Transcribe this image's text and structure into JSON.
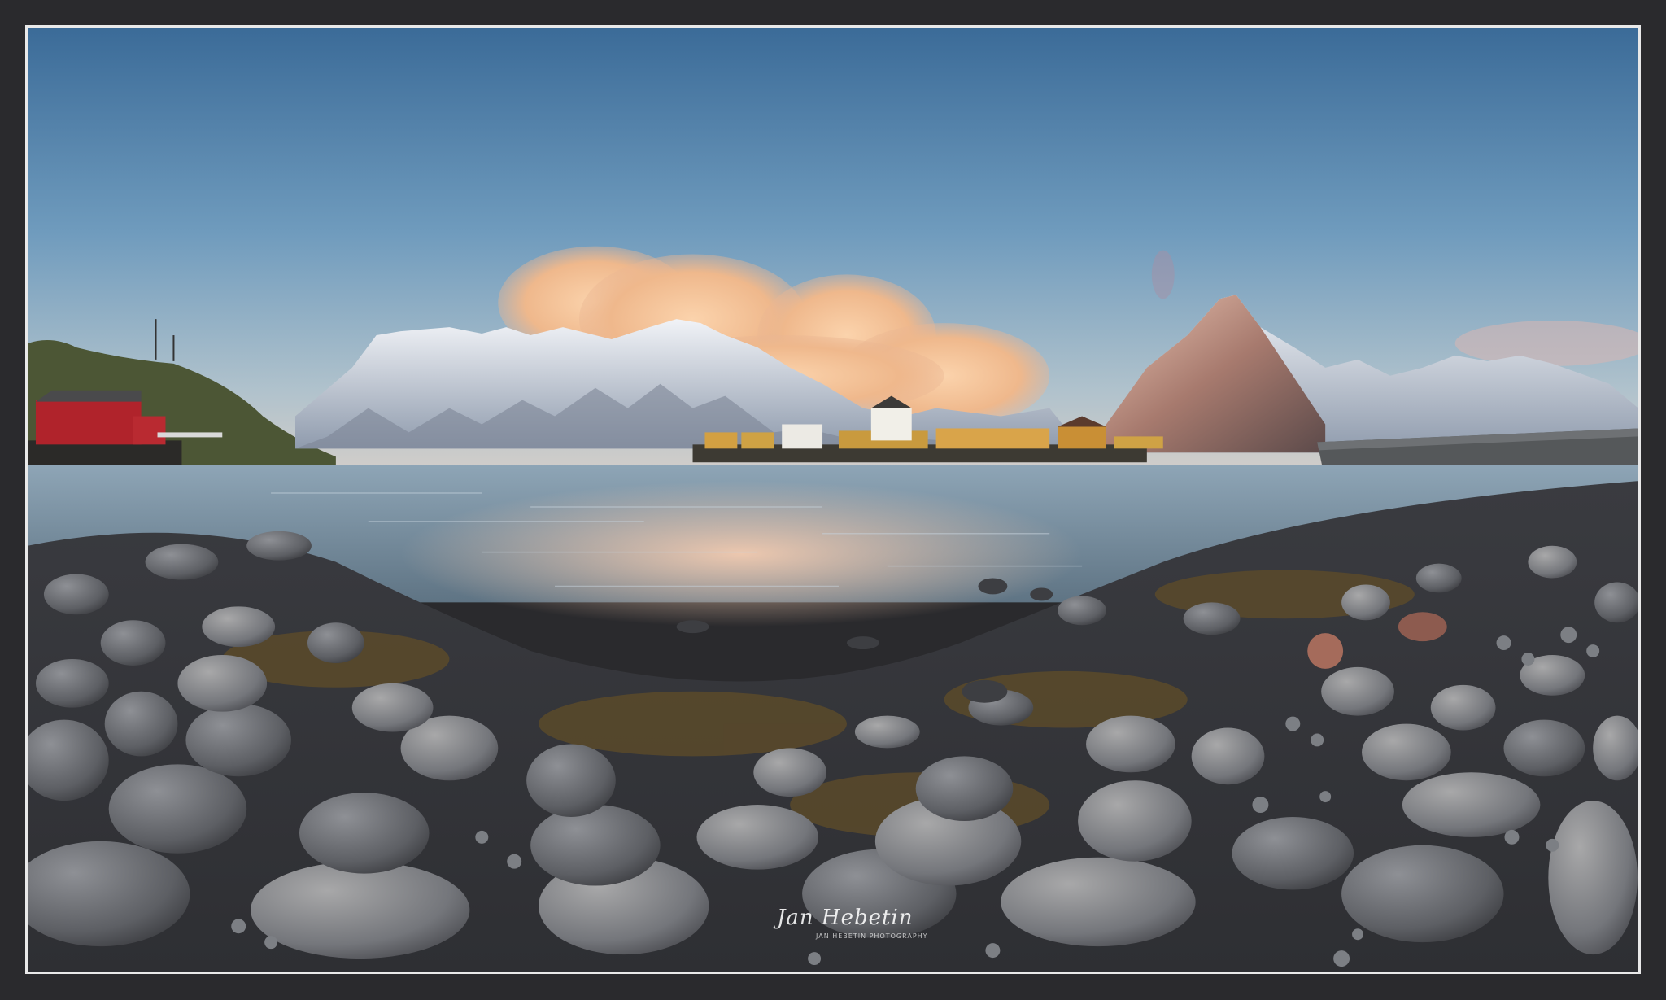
{
  "photo": {
    "colors": {
      "sky_top": "#3f6f9c",
      "sky_mid": "#7ea6c4",
      "sky_low": "#c7cdd0",
      "cloud": "#f5c79d",
      "snow": "#e9eef4",
      "snow_shadow": "#9aa8bb",
      "rock_peak": "#9b6d63",
      "water": "#8fa5b5",
      "water_glow": "#f0c4a5",
      "red_house": "#b0232b",
      "yellow_house": "#c99a3e",
      "stone": "#6b6d72",
      "seaweed": "#5a4a2b"
    },
    "signature": {
      "name": "Jan Hebetin",
      "sub": "JAN HEBETIN PHOTOGRAPHY"
    }
  }
}
